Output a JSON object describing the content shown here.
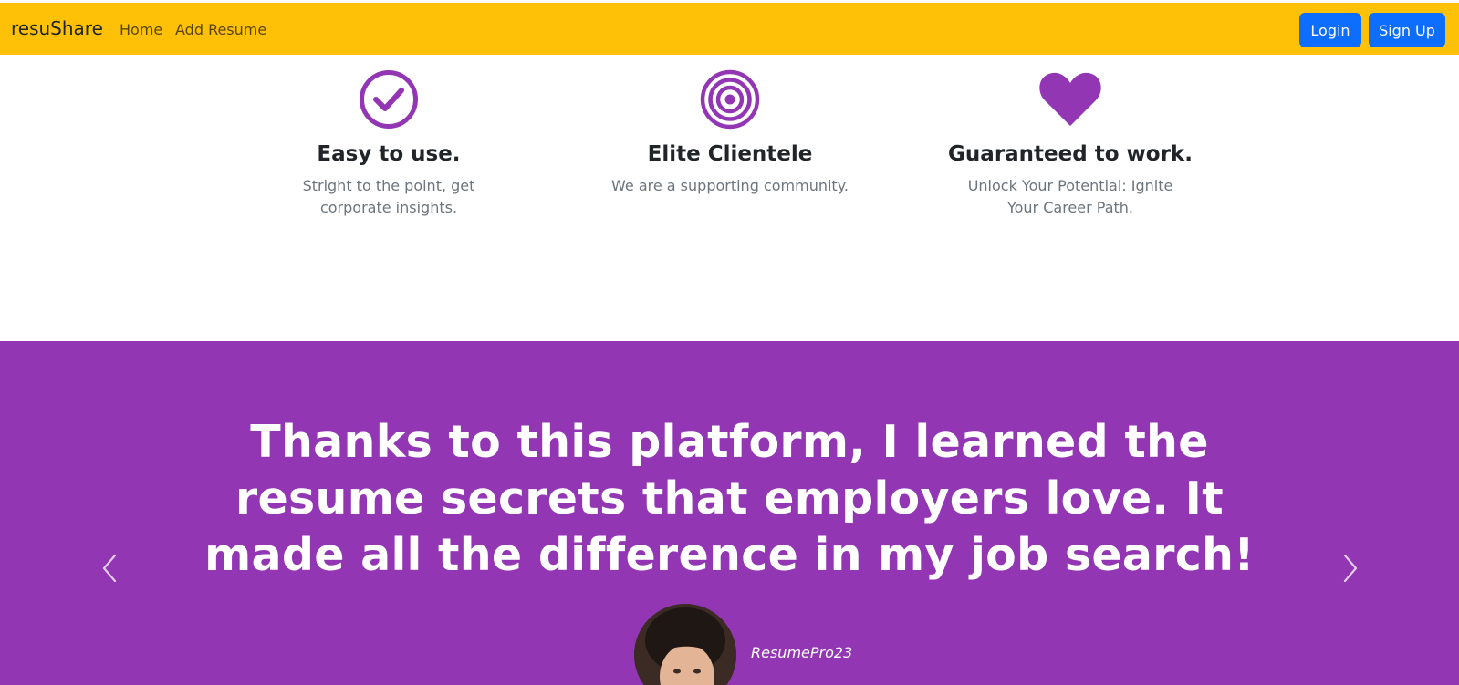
{
  "navbar": {
    "brand": "resuShare",
    "links": [
      "Home",
      "Add Resume"
    ],
    "login_label": "Login",
    "signup_label": "Sign Up",
    "background_color": "#ffc107",
    "button_color": "#0d6efd"
  },
  "features": [
    {
      "icon": "check-circle-icon",
      "title": "Easy to use.",
      "text": "Stright to the point, get corporate insights."
    },
    {
      "icon": "bullseye-icon",
      "title": "Elite Clientele",
      "text": "We are a supporting community."
    },
    {
      "icon": "heart-icon",
      "title": "Guaranteed to work.",
      "text": "Unlock Your Potential: Ignite Your Career Path."
    }
  ],
  "accent_color": "#9236b4",
  "testimonial": {
    "quote": "Thanks to this platform, I learned the resume secrets that employers love. It made all the difference in my job search!",
    "author": "ResumePro23",
    "prev_icon": "chevron-left-icon",
    "next_icon": "chevron-right-icon"
  }
}
